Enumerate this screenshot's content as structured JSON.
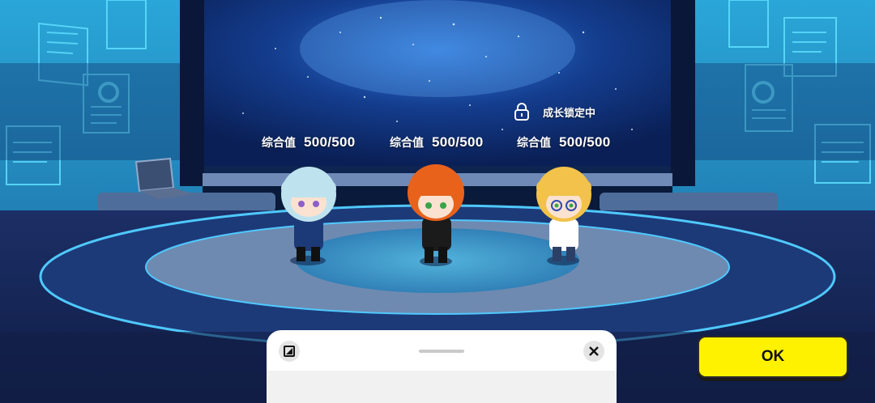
{
  "characters": [
    {
      "stat_label": "综合值",
      "stat_value": "500/500",
      "hair_color": "#bfe3ee",
      "outfit_color": "#1d3a78"
    },
    {
      "stat_label": "综合值",
      "stat_value": "500/500",
      "hair_color": "#e8621c",
      "outfit_color": "#1b1b1b"
    },
    {
      "stat_label": "综合值",
      "stat_value": "500/500",
      "hair_color": "#f2c24a",
      "outfit_color": "#ffffff"
    }
  ],
  "lock_status": {
    "text": "成长锁定中",
    "icon": "lock-icon"
  },
  "ok_button": {
    "label": "OK",
    "color": "#fff200"
  },
  "bottom_sheet": {
    "expand_icon": "expand-icon",
    "close_icon": "close-icon"
  },
  "colors": {
    "stage_glow": "#4fc9ff",
    "backdrop": "#0a1a3a"
  }
}
